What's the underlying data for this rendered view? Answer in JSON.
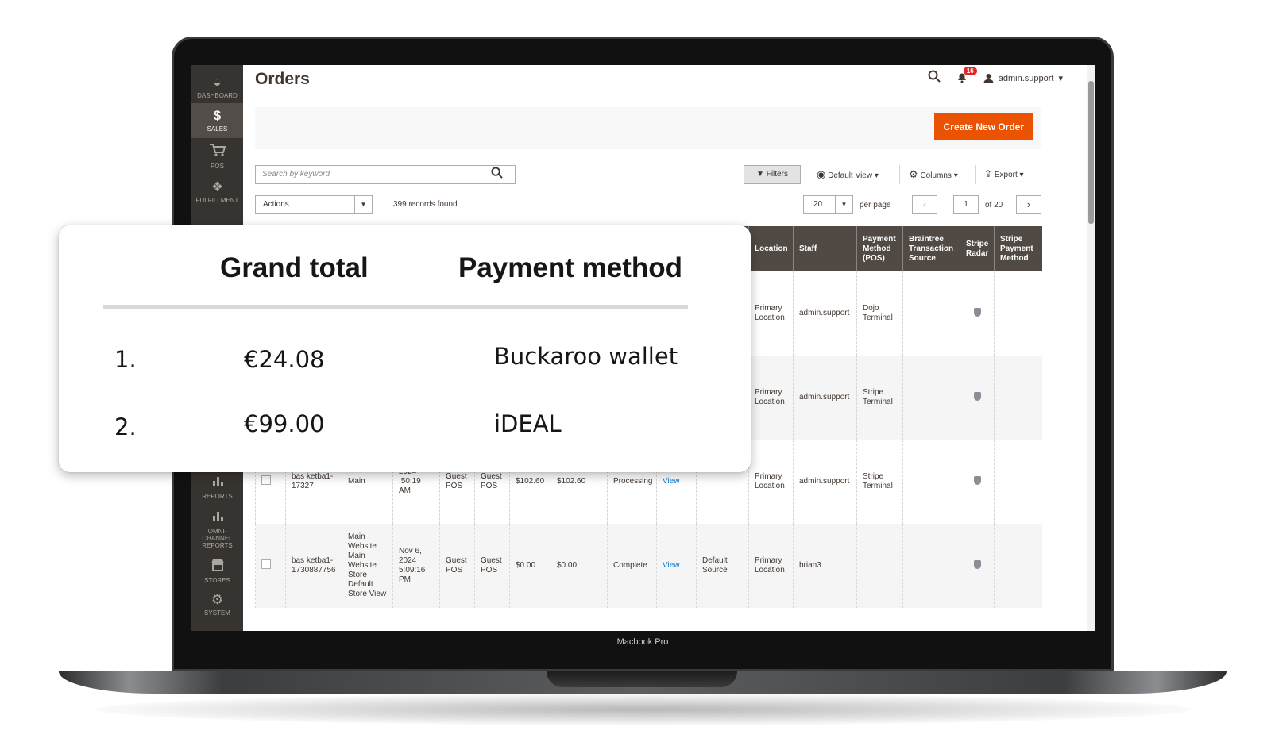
{
  "device_label": "Macbook Pro",
  "sidebar": {
    "items": [
      {
        "label": "DASHBOARD",
        "icon": "dashboard-icon",
        "active": false
      },
      {
        "label": "SALES",
        "icon": "dollar-icon",
        "active": true
      },
      {
        "label": "POS",
        "icon": "cart-icon",
        "active": false
      },
      {
        "label": "FULFILLMENT",
        "icon": "dropbox-icon",
        "active": false
      },
      {
        "label": "REPORTS",
        "icon": "bar-chart-icon",
        "active": false
      },
      {
        "label": "OMNI-CHANNEL REPORTS",
        "icon": "bar-chart-icon",
        "active": false
      },
      {
        "label": "STORES",
        "icon": "store-icon",
        "active": false
      },
      {
        "label": "SYSTEM",
        "icon": "gear-icon",
        "active": false
      }
    ]
  },
  "header": {
    "title": "Orders",
    "notifications_count": "16",
    "user": "admin.support"
  },
  "toolbar": {
    "create_label": "Create New Order",
    "search_placeholder": "Search by keyword",
    "filters_label": "Filters",
    "view_label": "Default View",
    "columns_label": "Columns",
    "export_label": "Export",
    "actions_label": "Actions",
    "records_found": "399 records found",
    "per_page_value": "20",
    "per_page_label": "per page",
    "page_value": "1",
    "page_of": "of 20"
  },
  "grid": {
    "headers": [
      "",
      "",
      "",
      "",
      "",
      "",
      "",
      "",
      "",
      "",
      "",
      "Location",
      "Staff",
      "Payment Method (POS)",
      "Braintree Transaction Source",
      "Stripe Radar",
      "Stripe Payment Method"
    ],
    "rows": [
      [
        "",
        "",
        "",
        "",
        "",
        "",
        "",
        "",
        "",
        "",
        "",
        "Primary Location",
        "admin.support",
        "Dojo Terminal",
        "",
        "",
        ""
      ],
      [
        "",
        "",
        "",
        "",
        "",
        "",
        "",
        "",
        "",
        "",
        "",
        "Primary Location",
        "admin.support",
        "Stripe Terminal",
        "",
        "",
        ""
      ],
      [
        "",
        "bas ketba1-17327",
        "Main",
        "2024 :50:19 AM",
        "Guest POS",
        "Guest POS",
        "$102.60",
        "$102.60",
        "Processing",
        "View",
        "",
        "Primary Location",
        "admin.support",
        "Stripe Terminal",
        "",
        "",
        ""
      ],
      [
        "",
        "bas ketba1-1730887756",
        "Main Website Main Website Store Default Store View",
        "Nov 6, 2024 5:09:16 PM",
        "Guest POS",
        "Guest POS",
        "$0.00",
        "$0.00",
        "Complete",
        "View",
        "Default Source",
        "Primary Location",
        "brian3.",
        "",
        "",
        "",
        ""
      ]
    ]
  },
  "card": {
    "col_total": "Grand total",
    "col_method": "Payment method",
    "rows": [
      {
        "index": "1.",
        "total": "€24.08",
        "method": "Buckaroo wallet"
      },
      {
        "index": "2.",
        "total": "€99.00",
        "method": "iDEAL"
      }
    ]
  }
}
